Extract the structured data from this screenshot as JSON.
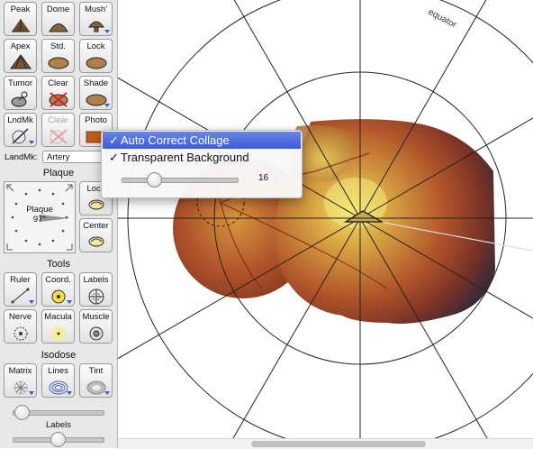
{
  "palette": {
    "tools_row1": [
      {
        "label": "Peak",
        "icon": "peak-icon"
      },
      {
        "label": "Dome",
        "icon": "dome-icon"
      },
      {
        "label": "Mush'",
        "icon": "mushroom-icon"
      }
    ],
    "tools_row2": [
      {
        "label": "Apex",
        "icon": "apex-icon"
      },
      {
        "label": "Std.",
        "icon": "standard-icon"
      },
      {
        "label": "Lock",
        "icon": "lock-icon"
      }
    ],
    "tools_row3": [
      {
        "label": "Tumor",
        "icon": "tumor-icon"
      },
      {
        "label": "Clear",
        "icon": "clear-icon"
      },
      {
        "label": "Shade",
        "icon": "shade-icon"
      }
    ],
    "tools_row4": [
      {
        "label": "LndMk",
        "icon": "landmark-icon"
      },
      {
        "label": "Clear",
        "icon": "clear-landmark-icon",
        "disabled": true
      },
      {
        "label": "Photo",
        "icon": "photo-icon"
      }
    ],
    "landmark_label": "LandMk:",
    "landmark_value": "Artery",
    "plaque_header": "Plaque",
    "plaque_widget_label": "Plaque",
    "plaque_angle": "97°",
    "lock_label": "Lock",
    "center_label": "Center",
    "tools_header": "Tools",
    "tools_row5": [
      {
        "label": "Ruler",
        "icon": "ruler-icon"
      },
      {
        "label": "Coord.",
        "icon": "coordinate-icon"
      },
      {
        "label": "Labels",
        "icon": "labels-icon"
      }
    ],
    "tools_row6": [
      {
        "label": "Nerve",
        "icon": "nerve-icon"
      },
      {
        "label": "Macula",
        "icon": "macula-icon"
      },
      {
        "label": "Muscle",
        "icon": "muscle-icon"
      }
    ],
    "isodose_header": "Isodose",
    "tools_row7": [
      {
        "label": "Matrix",
        "icon": "matrix-icon"
      },
      {
        "label": "Lines",
        "icon": "lines-icon"
      },
      {
        "label": "Tint",
        "icon": "tint-icon"
      }
    ],
    "isodose_slider_value": 0.1,
    "labels_slider_caption": "Labels",
    "labels_slider_value": 0.5
  },
  "canvas": {
    "equator_label": "equator"
  },
  "context_menu": {
    "items": [
      {
        "label": "Auto Correct Collage",
        "checked": "✓",
        "highlighted": true
      },
      {
        "label": "Transparent Background",
        "checked": "✓",
        "highlighted": false
      }
    ],
    "slider_value": "16",
    "slider_fraction": 0.28
  },
  "colors": {
    "menu_highlight": "#3b5bd6",
    "dropdown_triangle": "#3b58c8",
    "retina_orange": "#b8562c"
  }
}
